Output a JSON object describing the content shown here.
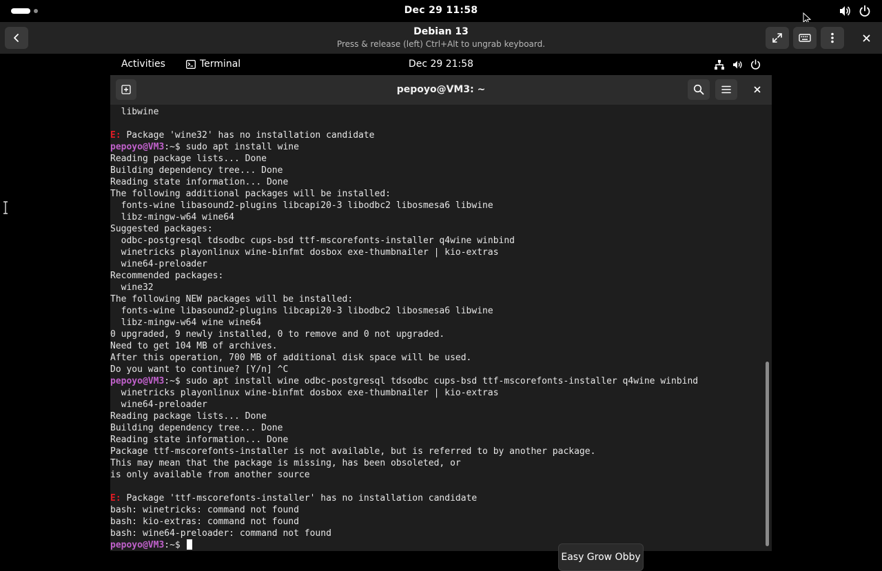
{
  "host_bar": {
    "datetime": "Dec 29  11:58"
  },
  "viewer": {
    "title": "Debian 13",
    "subtitle": "Press & release (left) Ctrl+Alt to ungrab keyboard."
  },
  "guest_topbar": {
    "activities": "Activities",
    "app_name": "Terminal",
    "datetime": "Dec 29  21:58"
  },
  "terminal": {
    "title": "pepoyo@VM3: ~",
    "prompt_user": "pepoyo@VM3",
    "lines": [
      "  libwine",
      "",
      "E: Package 'wine32' has no installation candidate",
      "pepoyo@VM3:~$ sudo apt install wine",
      "Reading package lists... Done",
      "Building dependency tree... Done",
      "Reading state information... Done",
      "The following additional packages will be installed:",
      "  fonts-wine libasound2-plugins libcapi20-3 libodbc2 libosmesa6 libwine",
      "  libz-mingw-w64 wine64",
      "Suggested packages:",
      "  odbc-postgresql tdsodbc cups-bsd ttf-mscorefonts-installer q4wine winbind",
      "  winetricks playonlinux wine-binfmt dosbox exe-thumbnailer | kio-extras",
      "  wine64-preloader",
      "Recommended packages:",
      "  wine32",
      "The following NEW packages will be installed:",
      "  fonts-wine libasound2-plugins libcapi20-3 libodbc2 libosmesa6 libwine",
      "  libz-mingw-w64 wine wine64",
      "0 upgraded, 9 newly installed, 0 to remove and 0 not upgraded.",
      "Need to get 104 MB of archives.",
      "After this operation, 700 MB of additional disk space will be used.",
      "Do you want to continue? [Y/n] ^C",
      "pepoyo@VM3:~$ sudo apt install wine odbc-postgresql tdsodbc cups-bsd ttf-mscorefonts-installer q4wine winbind",
      "  winetricks playonlinux wine-binfmt dosbox exe-thumbnailer | kio-extras",
      "  wine64-preloader",
      "Reading package lists... Done",
      "Building dependency tree... Done",
      "Reading state information... Done",
      "Package ttf-mscorefonts-installer is not available, but is referred to by another package.",
      "This may mean that the package is missing, has been obsoleted, or",
      "is only available from another source",
      "",
      "E: Package 'ttf-mscorefonts-installer' has no installation candidate",
      "bash: winetricks: command not found",
      "bash: kio-extras: command not found",
      "bash: wine64-preloader: command not found",
      "pepoyo@VM3:~$ "
    ]
  },
  "tooltip": {
    "text": "Easy Grow Obby"
  },
  "colors": {
    "prompt": "#c061cb",
    "error": "#e01b24",
    "terminal_bg": "#1e1e1e",
    "header_bg": "#2c2c2c"
  },
  "icons": {
    "host": [
      "volume-icon",
      "power-icon"
    ],
    "viewer": [
      "back-icon",
      "fullscreen-icon",
      "keyboard-icon",
      "kebab-menu-icon",
      "close-icon"
    ],
    "guest": [
      "terminal-icon",
      "network-icon",
      "volume-icon",
      "power-icon"
    ],
    "terminal": [
      "new-tab-icon",
      "search-icon",
      "hamburger-menu-icon",
      "close-icon"
    ]
  }
}
